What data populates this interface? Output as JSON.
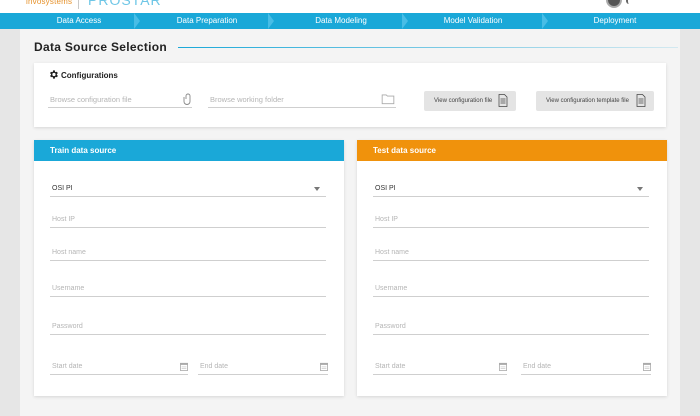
{
  "brand": {
    "company": "invosystems",
    "product": "PROSTAR"
  },
  "steps": [
    "Data Access",
    "Data Preparation",
    "Data Modeling",
    "Model Validation",
    "Deployment"
  ],
  "page_title": "Data Source Selection",
  "configurations": {
    "heading": "Configurations",
    "browse_config_placeholder": "Browse configuration file",
    "browse_folder_placeholder": "Browse working folder",
    "view_config_button": "View configuration file",
    "view_template_button": "View configuration template file"
  },
  "train": {
    "header": "Train data source",
    "source_type": "OSI PI",
    "host_ip": "Host IP",
    "host_name": "Host name",
    "username": "Username",
    "password": "Password",
    "start_date": "Start date",
    "end_date": "End date"
  },
  "test": {
    "header": "Test data source",
    "source_type": "OSI PI",
    "host_ip": "Host IP",
    "host_name": "Host name",
    "username": "Username",
    "password": "Password",
    "start_date": "Start date",
    "end_date": "End date"
  },
  "colors": {
    "accent_blue": "#1aa8d8",
    "accent_orange": "#f0920c",
    "brand_orange": "#e6922c"
  }
}
